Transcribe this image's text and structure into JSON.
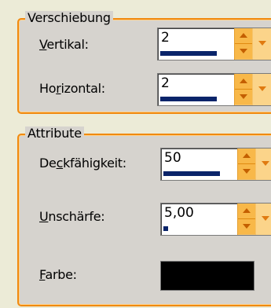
{
  "verschiebung": {
    "title": "Verschiebung",
    "vertical": {
      "label_u": "V",
      "label_rest": "ertikal:",
      "value": "2",
      "level": 0.5
    },
    "horizontal": {
      "label_pre": "Ho",
      "label_u": "r",
      "label_rest": "izontal:",
      "value": "2",
      "level": 0.5
    }
  },
  "attribute": {
    "title": "Attribute",
    "opacity": {
      "label_pre": "De",
      "label_u": "c",
      "label_rest": "kfähigkeit:",
      "value": "50",
      "level": 0.5
    },
    "blur": {
      "label_u": "U",
      "label_rest": "nschärfe:",
      "value": "5,00",
      "level": 0.04
    },
    "color": {
      "label_u": "F",
      "label_rest": "arbe:",
      "value": "#000000"
    }
  },
  "colors": {
    "accent": "#f08a10",
    "panel": "#d6d3ce",
    "bar": "#0a246a"
  }
}
